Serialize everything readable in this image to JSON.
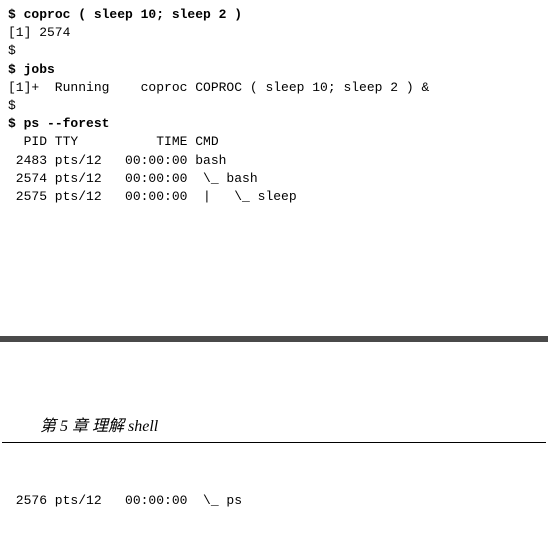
{
  "terminal": {
    "l1_prompt": "$ ",
    "l1_cmd": "coproc ( sleep 10; sleep 2 )",
    "l2": "[1] 2574",
    "l3": "$",
    "l4_prompt": "$ ",
    "l4_cmd": "jobs",
    "l5": "[1]+  Running    coproc COPROC ( sleep 10; sleep 2 ) &",
    "l6": "$",
    "l7_prompt": "$ ",
    "l7_cmd": "ps --forest",
    "l8": "  PID TTY          TIME CMD",
    "l9": " 2483 pts/12   00:00:00 bash",
    "l10": " 2574 pts/12   00:00:00  \\_ bash",
    "l11": " 2575 pts/12   00:00:00  |   \\_ sleep"
  },
  "chapter": {
    "label": "第 5 章   理解 shell"
  },
  "footer": {
    "line": " 2576 pts/12   00:00:00  \\_ ps"
  }
}
